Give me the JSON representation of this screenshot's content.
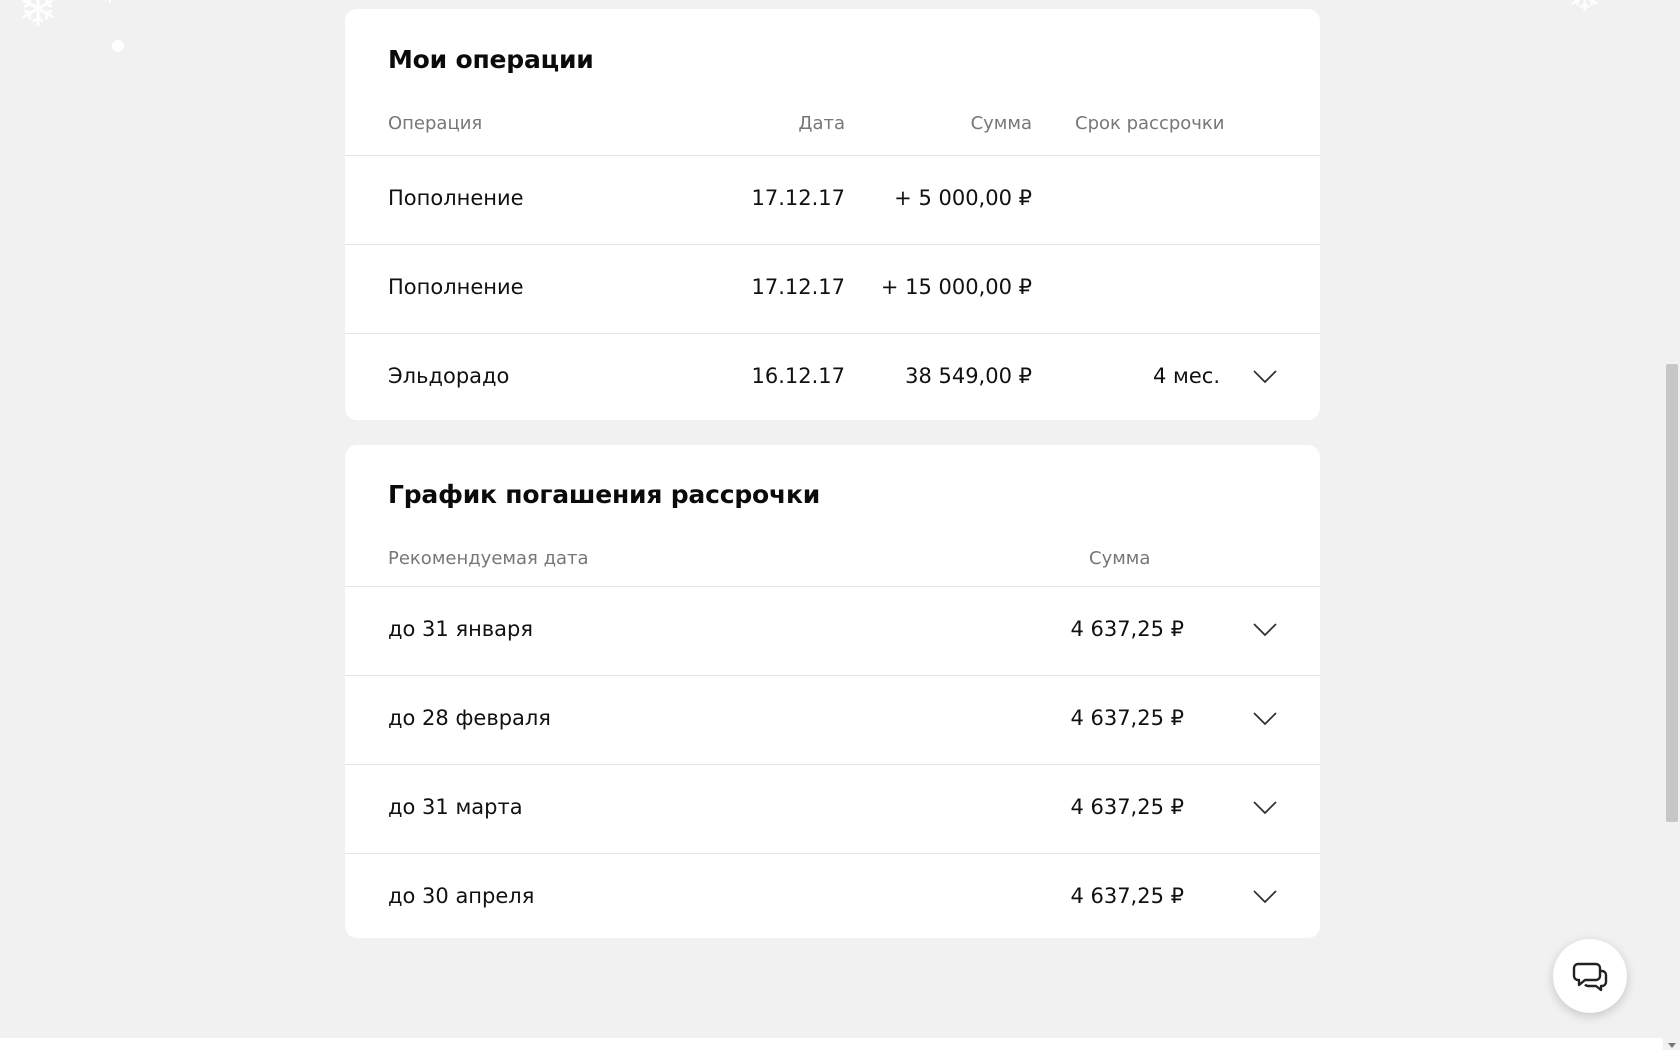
{
  "operations": {
    "title": "Мои операции",
    "headers": {
      "operation": "Операция",
      "date": "Дата",
      "amount": "Сумма",
      "term": "Срок рассрочки"
    },
    "rows": [
      {
        "operation": "Пополнение",
        "date": "17.12.17",
        "amount": "+ 5 000,00 ₽",
        "term": ""
      },
      {
        "operation": "Пополнение",
        "date": "17.12.17",
        "amount": "+ 15 000,00 ₽",
        "term": ""
      },
      {
        "operation": "Эльдорадо",
        "date": "16.12.17",
        "amount": "38 549,00 ₽",
        "term": "4 мес."
      }
    ]
  },
  "schedule": {
    "title": "График погашения рассрочки",
    "headers": {
      "date": "Рекомендуемая дата",
      "amount": "Сумма"
    },
    "rows": [
      {
        "date": "до 31 января",
        "amount": "4 637,25 ₽"
      },
      {
        "date": "до 28 февраля",
        "amount": "4 637,25 ₽"
      },
      {
        "date": "до 31 марта",
        "amount": "4 637,25 ₽"
      },
      {
        "date": "до 30 апреля",
        "amount": "4 637,25 ₽"
      }
    ]
  },
  "icons": {
    "expand": "chevron-down-icon",
    "chat": "chat-bubbles-icon",
    "decor": "snowflake-icon"
  },
  "colors": {
    "background": "#f0f1f0",
    "card": "#ffffff",
    "text": "#111111",
    "muted": "#777777",
    "divider": "#e4e4e4"
  }
}
